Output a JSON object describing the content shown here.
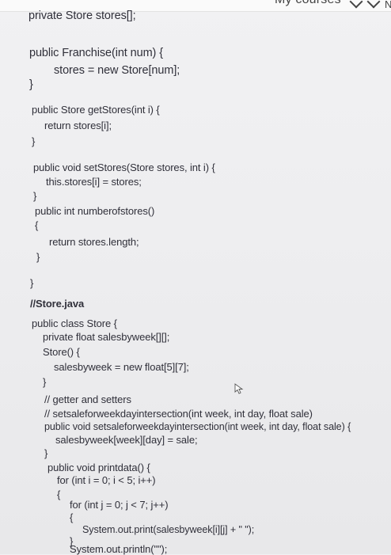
{
  "header": {
    "my_courses": "My courses",
    "cut_letter": "N"
  },
  "code_lines": [
    "private Store stores[];",
    "public Franchise(int num) {",
    "stores = new Store[num];",
    "}",
    "public Store getStores(int i) {",
    "return stores[i];",
    "}",
    "public void setStores(Store stores, int i) {",
    "this.stores[i] = stores;",
    "}",
    "public int numberofstores()",
    "{",
    "return stores.length;",
    "}",
    "}",
    "//Store.java",
    "public class Store {",
    "private float salesbyweek[][];",
    "Store() {",
    "salesbyweek = new float[5][7];",
    "}",
    "// getter and setters",
    "// setsaleforweekdayintersection(int week, int day, float sale)",
    "public void setsaleforweekdayintersection(int week, int day, float sale) {",
    "salesbyweek[week][day] = sale;",
    "}",
    "public void printdata() {",
    "for (int i = 0; i < 5; i++)",
    "{",
    "for (int j = 0; j < 7; j++)",
    "{",
    "System.out.print(salesbyweek[i][j] + \" \");",
    "}",
    "System.out.println(\"\");"
  ]
}
